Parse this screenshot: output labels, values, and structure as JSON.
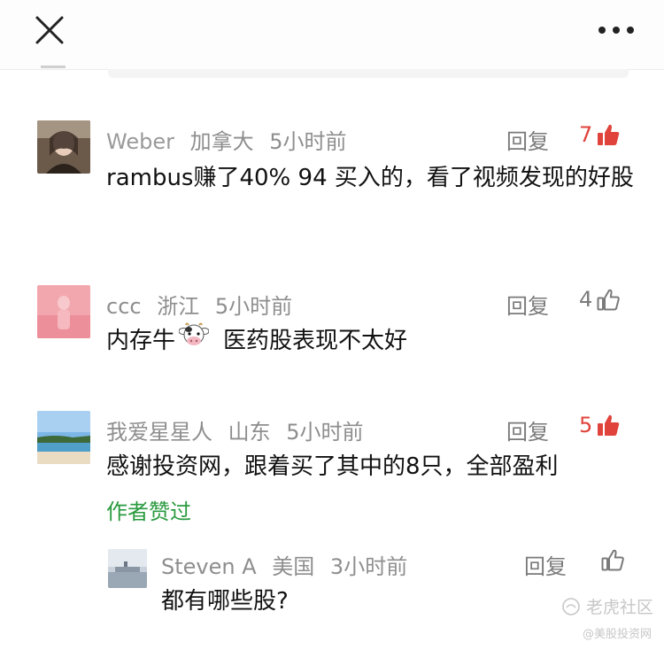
{
  "header": {
    "close_icon": "close-icon",
    "more_icon": "more-icon"
  },
  "comments": [
    {
      "name": "Weber",
      "location": "加拿大",
      "time": "5小时前",
      "reply_label": "回复",
      "likes": "7",
      "liked": true,
      "text": "rambus赚了40% 94 买入的，看了视频发现的好股"
    },
    {
      "name": "ccc",
      "location": "浙江",
      "time": "5小时前",
      "reply_label": "回复",
      "likes": "4",
      "liked": false,
      "text_before_emoji": "内存牛",
      "emoji": "cow-face-emoji",
      "text_after_emoji": "医药股表现不太好"
    },
    {
      "name": "我爱星星人",
      "location": "山东",
      "time": "5小时前",
      "reply_label": "回复",
      "likes": "5",
      "liked": true,
      "text": "感谢投资网，跟着买了其中的8只，全部盈利",
      "author_liked": "作者赞过"
    }
  ],
  "reply_thread": {
    "name": "Steven A",
    "location": "美国",
    "time": "3小时前",
    "reply_label": "回复",
    "text": "都有哪些股?"
  },
  "watermark": {
    "brand": "老虎社区",
    "handle": "@美股投资网"
  },
  "colors": {
    "liked_red": "#e0433b",
    "author_green": "#2a9a3f",
    "meta_gray": "#8e8e8e"
  }
}
